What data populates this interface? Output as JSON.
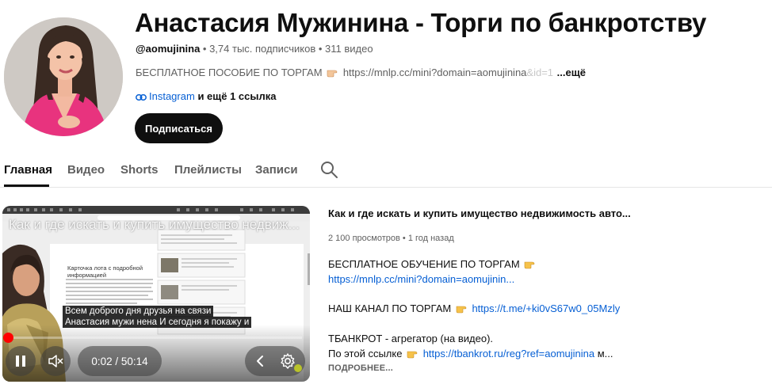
{
  "channel": {
    "name": "Анастасия Мужинина - Торги по банкротству",
    "handle": "@aomujinina",
    "meta_sep": " • ",
    "subscribers": "3,74 тыс. подписчиков",
    "videos": "311 видео",
    "description_text": "БЕСПЛАТНОЕ ПОСОБИЕ ПО ТОРГАМ",
    "description_link": "https://mnlp.cc/mini?domain=aomujinina",
    "description_link_faded": "&id=1",
    "description_more": "...ещё",
    "link_name": "Instagram",
    "links_more": "и ещё 1 ссылка",
    "subscribe_label": "Подписаться"
  },
  "tabs": [
    {
      "label": "Главная",
      "active": true
    },
    {
      "label": "Видео",
      "active": false
    },
    {
      "label": "Shorts",
      "active": false
    },
    {
      "label": "Плейлисты",
      "active": false
    },
    {
      "label": "Записи",
      "active": false
    }
  ],
  "player": {
    "overlay_title": "Как и где искать и купить имущество недвиж...",
    "caption_1": "Всем доброго дня друзья на связи",
    "caption_2": "Анастасия мужи нена И сегодня я покажу и",
    "slide_heading": "Карточка лота с подробной информацией",
    "time": "0:02 / 50:14",
    "progress": 0.0007
  },
  "video": {
    "title": "Как и где искать и купить имущество недвижимость авто...",
    "views": "2 100 просмотров",
    "age": "1 год назад",
    "meta_sep": " • ",
    "line1_text": "БЕСПЛАТНОЕ ОБУЧЕНИЕ ПО ТОРГАМ",
    "line1_link": "https://mnlp.cc/mini?domain=aomujinin...",
    "line2_text": "НАШ КАНАЛ ПО ТОРГАМ",
    "line2_link": "https://t.me/+ki0vS67w0_05Mzly",
    "line3_text": "ТБАНКРОТ - агрегатор (на видео).",
    "line4_text": "По этой ссылке",
    "line4_link": "https://tbankrot.ru/reg?ref=aomujinina",
    "line4_tail": " м...",
    "more_label": "ПОДРОБНЕЕ..."
  },
  "colors": {
    "link": "#065fd4",
    "subscribe_bg": "#0f0f0f",
    "progress": "#ff0000",
    "muted_text": "#606060",
    "jacket_pink": "#e8337e"
  },
  "icons": {
    "pointing_hand": "backhand-index-pointing-right-emoji",
    "link": "link-icon",
    "search": "search-icon"
  }
}
